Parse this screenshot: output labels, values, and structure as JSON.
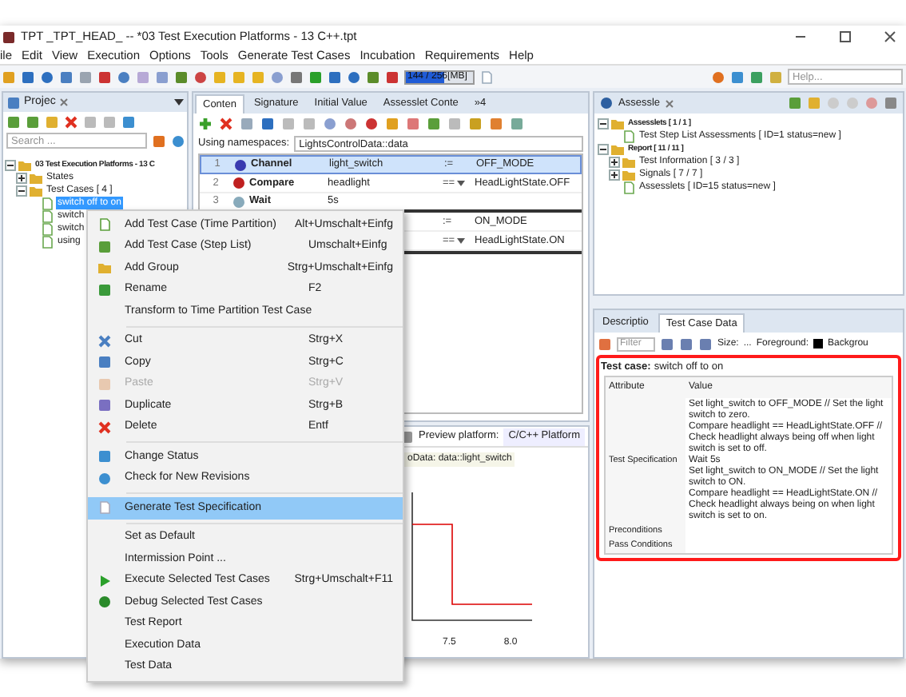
{
  "window": {
    "title": "TPT _TPT_HEAD_ -- *03 Test Execution Platforms - 13 C++.tpt"
  },
  "menu_bar": [
    "ile",
    "Edit",
    "View",
    "Execution",
    "Options",
    "Tools",
    "Generate Test Cases",
    "Incubation",
    "Requirements",
    "Help"
  ],
  "toolbar": {
    "memory": {
      "text": "144 / 256[MB]",
      "level": 0.56
    },
    "help_search": {
      "placeholder": "Help..."
    }
  },
  "project_panel": {
    "tab": "Projec",
    "search": {
      "placeholder": "Search ..."
    },
    "tree": [
      {
        "label": "03 Test Execution Platforms - 13 C",
        "expanded": true,
        "selected": false,
        "children": [
          {
            "label": "States",
            "expanded": false,
            "selected": false
          },
          {
            "label": "Test Cases  [ 4 ]",
            "expanded": true,
            "selected": false,
            "children": [
              {
                "label": "switch off to on",
                "selected": true
              },
              {
                "label": "switch",
                "selected": false
              },
              {
                "label": "switch",
                "selected": false
              },
              {
                "label": "using",
                "selected": false
              }
            ]
          }
        ]
      }
    ]
  },
  "content_panel": {
    "tabs": [
      {
        "label": "Conten",
        "selected": true
      },
      {
        "label": "Signature",
        "selected": false
      },
      {
        "label": "Initial Value",
        "selected": false
      },
      {
        "label": "Assesslet Conte",
        "selected": false
      }
    ],
    "overflow": "»4",
    "namespaces": {
      "label": "Using namespaces:",
      "value": "LightsControlData::data"
    },
    "steps": [
      {
        "number": "1",
        "kind": "channel",
        "name": "Channel",
        "signal": "light_switch",
        "operator": ":=",
        "value": "OFF_MODE",
        "selected": true
      },
      {
        "number": "2",
        "kind": "compare",
        "name": "Compare",
        "signal": "headlight",
        "operator": "==",
        "value": "HeadLightState.OFF",
        "selected": false
      },
      {
        "number": "3",
        "kind": "wait",
        "name": "Wait",
        "signal": "5s",
        "selected": false
      },
      {
        "kind": "channel",
        "operator": ":=",
        "value": "ON_MODE",
        "selected": false
      },
      {
        "kind": "compare",
        "operator": "==",
        "value": "HeadLightState.ON",
        "selected": false
      }
    ],
    "preview": {
      "label": "Preview platform:",
      "platform": "C/C++ Platform",
      "signal": "oData: data::light_switch",
      "ticks": [
        "7.5",
        "8.0"
      ]
    }
  },
  "assesslets_panel": {
    "tab": "Assessle",
    "tree": [
      {
        "label": "Assesslets  [ 1 / 1 ]",
        "expanded": true,
        "children": [
          {
            "label": "Test Step List Assessments  [ ID=1 status=new ]"
          }
        ]
      },
      {
        "label": "Report  [ 11 / 11 ]",
        "expanded": true,
        "children": [
          {
            "label": "Test Information  [ 3 / 3 ]",
            "expanded": false
          },
          {
            "label": "Signals  [ 7 / 7 ]",
            "expanded": false
          },
          {
            "label": "Assesslets  [ ID=15 status=new ]"
          }
        ]
      }
    ]
  },
  "test_case_data_panel": {
    "tabs": [
      {
        "label": "Descriptio",
        "selected": false
      },
      {
        "label": "Test Case Data",
        "selected": true
      }
    ],
    "filter": {
      "placeholder": "Filter"
    },
    "size_label": "Size:",
    "size_value": "...",
    "foreground_label": "Foreground:",
    "background_label": "Backgrou",
    "test_case_label": "Test case:",
    "test_case": "switch off to on",
    "columns": [
      "Attribute",
      "Value"
    ],
    "rows": [
      {
        "attribute": "Test Specification",
        "value": [
          "Set light_switch to OFF_MODE // Set the light switch to zero.",
          "Compare headlight == HeadLightState.OFF // Check headlight always being off when light switch is set to off.",
          "Wait 5s",
          "Set light_switch to ON_MODE // Set the light switch to ON.",
          "Compare headlight == HeadLightState.ON // Check headlight always being on when light switch is set to on."
        ]
      },
      {
        "attribute": "Preconditions"
      },
      {
        "attribute": "Pass Conditions"
      }
    ]
  },
  "context_menu": [
    {
      "kind": "item",
      "label": "Add Test Case (Time Partition)",
      "shortcut": "Alt+Umschalt+Einfg",
      "disabled": false,
      "selected": false
    },
    {
      "kind": "item",
      "label": "Add Test Case (Step List)",
      "shortcut": "Umschalt+Einfg",
      "disabled": false,
      "selected": false
    },
    {
      "kind": "item",
      "label": "Add Group",
      "shortcut": "Strg+Umschalt+Einfg",
      "disabled": false,
      "selected": false
    },
    {
      "kind": "item",
      "label": "Rename",
      "shortcut": "F2",
      "disabled": false,
      "selected": false
    },
    {
      "kind": "item",
      "label": "Transform to Time Partition Test Case",
      "disabled": false,
      "selected": false
    },
    {
      "kind": "separator"
    },
    {
      "kind": "item",
      "label": "Cut",
      "shortcut": "Strg+X",
      "disabled": false,
      "selected": false
    },
    {
      "kind": "item",
      "label": "Copy",
      "shortcut": "Strg+C",
      "disabled": false,
      "selected": false
    },
    {
      "kind": "item",
      "label": "Paste",
      "shortcut": "Strg+V",
      "disabled": true,
      "selected": false
    },
    {
      "kind": "item",
      "label": "Duplicate",
      "shortcut": "Strg+B",
      "disabled": false,
      "selected": false
    },
    {
      "kind": "item",
      "label": "Delete",
      "shortcut": "Entf",
      "disabled": false,
      "selected": false
    },
    {
      "kind": "separator"
    },
    {
      "kind": "item",
      "label": "Change Status",
      "disabled": false,
      "selected": false
    },
    {
      "kind": "item",
      "label": "Check for New Revisions",
      "disabled": false,
      "selected": false
    },
    {
      "kind": "separator"
    },
    {
      "kind": "item",
      "label": "Generate Test Specification",
      "disabled": false,
      "selected": true
    },
    {
      "kind": "separator"
    },
    {
      "kind": "item",
      "label": "Set as Default",
      "disabled": false,
      "selected": false
    },
    {
      "kind": "item",
      "label": "Intermission Point ...",
      "disabled": false,
      "selected": false
    },
    {
      "kind": "item",
      "label": "Execute Selected Test Cases",
      "shortcut": "Strg+Umschalt+F11",
      "disabled": false,
      "selected": false
    },
    {
      "kind": "item",
      "label": "Debug Selected Test Cases",
      "disabled": false,
      "selected": false
    },
    {
      "kind": "item",
      "label": "Test Report",
      "disabled": false,
      "selected": false
    },
    {
      "kind": "item",
      "label": "Execution Data",
      "disabled": false,
      "selected": false
    },
    {
      "kind": "item",
      "label": "Test Data",
      "disabled": false,
      "selected": false
    }
  ]
}
